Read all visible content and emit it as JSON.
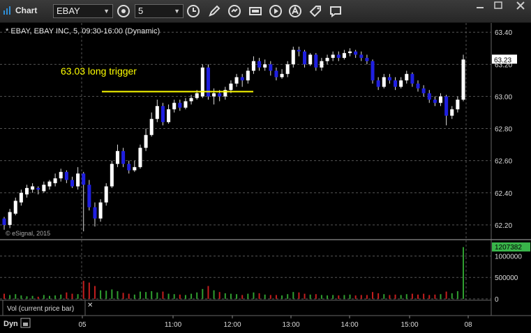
{
  "window": {
    "title": "Chart"
  },
  "toolbar": {
    "symbol": "EBAY",
    "interval": "5"
  },
  "chart": {
    "header": "* EBAY, EBAY INC, 5, 09:30-16:00 (Dynamic)",
    "watermark": "© eSignal, 2015",
    "annotation": "63.03 long trigger",
    "price_tag": "63.23",
    "volume_tag": "1207382",
    "volume_label": "Vol (current price bar)",
    "mode_label": "Dyn",
    "colors": {
      "up": "#ffffff",
      "down": "#1f1fe0",
      "annotation": "#ffff00",
      "price_tag": "#ffffff",
      "volume_tag": "#39b54a",
      "vol_up": "#2f9e2f",
      "vol_down": "#c41e1e",
      "grid": "#555555"
    }
  },
  "chart_data": {
    "type": "candlestick",
    "price_axis": {
      "ticks": [
        "63.40",
        "63.20",
        "63.00",
        "62.80",
        "62.60",
        "62.40",
        "62.20"
      ],
      "ylim": [
        62.13,
        63.44
      ]
    },
    "volume_axis": {
      "ticks": [
        "1000000",
        "500000",
        "0"
      ],
      "ylim": [
        0,
        1300000
      ]
    },
    "time_axis": {
      "ticks": [
        "05",
        "11:00",
        "12:00",
        "13:00",
        "14:00",
        "15:00",
        "08"
      ]
    },
    "trigger_level": 63.03,
    "candles": [
      [
        62.24,
        62.2,
        62.25,
        62.17
      ],
      [
        62.2,
        62.28,
        62.3,
        62.18
      ],
      [
        62.27,
        62.35,
        62.37,
        62.26
      ],
      [
        62.34,
        62.4,
        62.42,
        62.32
      ],
      [
        62.39,
        62.43,
        62.45,
        62.37
      ],
      [
        62.42,
        62.44,
        62.46,
        62.4
      ],
      [
        62.43,
        62.42,
        62.44,
        62.39
      ],
      [
        62.41,
        62.45,
        62.47,
        62.4
      ],
      [
        62.44,
        62.47,
        62.48,
        62.42
      ],
      [
        62.46,
        62.49,
        62.52,
        62.44
      ],
      [
        62.49,
        62.53,
        62.55,
        62.47
      ],
      [
        62.53,
        62.48,
        62.54,
        62.46
      ],
      [
        62.48,
        62.44,
        62.5,
        62.43
      ],
      [
        62.44,
        62.52,
        62.56,
        62.42
      ],
      [
        62.52,
        62.45,
        62.53,
        62.16
      ],
      [
        62.45,
        62.31,
        62.48,
        62.29
      ],
      [
        62.31,
        62.24,
        62.34,
        62.19
      ],
      [
        62.24,
        62.34,
        62.36,
        62.22
      ],
      [
        62.34,
        62.44,
        62.46,
        62.32
      ],
      [
        62.44,
        62.58,
        62.6,
        62.43
      ],
      [
        62.58,
        62.66,
        62.7,
        62.56
      ],
      [
        62.66,
        62.58,
        62.68,
        62.56
      ],
      [
        62.58,
        62.54,
        62.6,
        62.52
      ],
      [
        62.54,
        62.56,
        62.6,
        62.53
      ],
      [
        62.56,
        62.68,
        62.7,
        62.55
      ],
      [
        62.68,
        62.76,
        62.8,
        62.66
      ],
      [
        62.76,
        62.86,
        62.9,
        62.75
      ],
      [
        62.86,
        62.94,
        62.98,
        62.84
      ],
      [
        62.94,
        62.84,
        62.96,
        62.82
      ],
      [
        62.84,
        62.92,
        62.95,
        62.83
      ],
      [
        62.92,
        62.96,
        62.98,
        62.9
      ],
      [
        62.96,
        62.93,
        62.98,
        62.91
      ],
      [
        62.93,
        62.97,
        62.99,
        62.92
      ],
      [
        62.97,
        62.99,
        63.01,
        62.95
      ],
      [
        62.99,
        63.02,
        63.04,
        62.98
      ],
      [
        63.0,
        63.18,
        63.2,
        62.99
      ],
      [
        63.18,
        63.0,
        63.2,
        62.98
      ],
      [
        63.0,
        63.02,
        63.05,
        62.95
      ],
      [
        63.02,
        63.0,
        63.04,
        62.97
      ],
      [
        63.0,
        63.04,
        63.06,
        62.98
      ],
      [
        63.04,
        63.08,
        63.1,
        63.02
      ],
      [
        63.08,
        63.12,
        63.14,
        63.06
      ],
      [
        63.12,
        63.1,
        63.14,
        63.06
      ],
      [
        63.1,
        63.16,
        63.18,
        63.08
      ],
      [
        63.16,
        63.22,
        63.25,
        63.14
      ],
      [
        63.22,
        63.18,
        63.24,
        63.16
      ],
      [
        63.18,
        63.2,
        63.23,
        63.16
      ],
      [
        63.2,
        63.16,
        63.22,
        63.13
      ],
      [
        63.16,
        63.12,
        63.18,
        63.1
      ],
      [
        63.12,
        63.14,
        63.17,
        63.11
      ],
      [
        63.14,
        63.2,
        63.22,
        63.12
      ],
      [
        63.2,
        63.29,
        63.31,
        63.18
      ],
      [
        63.29,
        63.28,
        63.31,
        63.25
      ],
      [
        63.28,
        63.2,
        63.29,
        63.18
      ],
      [
        63.2,
        63.26,
        63.27,
        63.19
      ],
      [
        63.26,
        63.18,
        63.27,
        63.16
      ],
      [
        63.18,
        63.22,
        63.24,
        63.16
      ],
      [
        63.22,
        63.24,
        63.26,
        63.2
      ],
      [
        63.24,
        63.26,
        63.28,
        63.22
      ],
      [
        63.26,
        63.24,
        63.28,
        63.22
      ],
      [
        63.24,
        63.27,
        63.29,
        63.23
      ],
      [
        63.27,
        63.28,
        63.3,
        63.25
      ],
      [
        63.28,
        63.26,
        63.29,
        63.24
      ],
      [
        63.26,
        63.24,
        63.28,
        63.22
      ],
      [
        63.24,
        63.22,
        63.26,
        63.2
      ],
      [
        63.22,
        63.1,
        63.23,
        63.08
      ],
      [
        63.1,
        63.06,
        63.12,
        63.04
      ],
      [
        63.06,
        63.12,
        63.14,
        63.05
      ],
      [
        63.12,
        63.1,
        63.14,
        63.08
      ],
      [
        63.1,
        63.06,
        63.12,
        63.04
      ],
      [
        63.06,
        63.1,
        63.12,
        63.05
      ],
      [
        63.1,
        63.14,
        63.16,
        63.08
      ],
      [
        63.14,
        63.08,
        63.15,
        63.06
      ],
      [
        63.08,
        63.05,
        63.1,
        63.03
      ],
      [
        63.05,
        63.02,
        63.07,
        63.0
      ],
      [
        63.02,
        62.98,
        63.04,
        62.96
      ],
      [
        62.98,
        62.96,
        63.0,
        62.94
      ],
      [
        62.96,
        63.0,
        63.02,
        62.94
      ],
      [
        63.0,
        62.88,
        63.01,
        62.82
      ],
      [
        62.88,
        62.92,
        62.94,
        62.86
      ],
      [
        62.92,
        62.98,
        63.0,
        62.9
      ],
      [
        62.98,
        63.23,
        63.26,
        62.97
      ]
    ],
    "volume": [
      120000,
      90000,
      110000,
      80000,
      60000,
      70000,
      50000,
      90000,
      70000,
      80000,
      100000,
      150000,
      120000,
      110000,
      420000,
      380000,
      300000,
      200000,
      190000,
      220000,
      180000,
      140000,
      120000,
      100000,
      170000,
      160000,
      180000,
      150000,
      170000,
      120000,
      110000,
      100000,
      90000,
      120000,
      150000,
      230000,
      300000,
      200000,
      160000,
      130000,
      120000,
      110000,
      90000,
      120000,
      150000,
      130000,
      100000,
      90000,
      90000,
      80000,
      110000,
      160000,
      150000,
      120000,
      100000,
      110000,
      90000,
      80000,
      90000,
      80000,
      90000,
      100000,
      80000,
      90000,
      90000,
      160000,
      130000,
      110000,
      90000,
      100000,
      90000,
      110000,
      120000,
      100000,
      120000,
      90000,
      100000,
      110000,
      170000,
      130000,
      180000,
      1207382
    ]
  }
}
